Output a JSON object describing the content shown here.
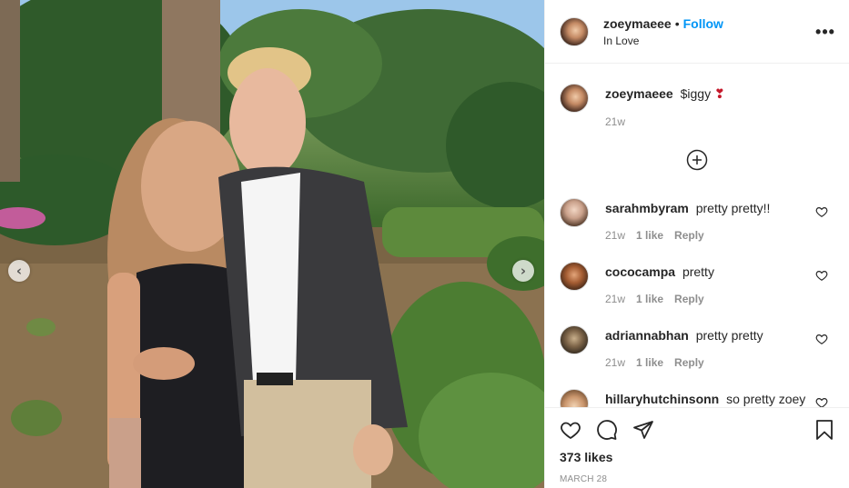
{
  "post": {
    "username": "zoeymaeee",
    "follow_label": "Follow",
    "separator": "•",
    "location": "In Love",
    "more_label": "•••"
  },
  "caption": {
    "username": "zoeymaeee",
    "text": "$iggy",
    "emoji": "❣",
    "time": "21w"
  },
  "comments": [
    {
      "username": "sarahmbyram",
      "text": "pretty pretty!!",
      "time": "21w",
      "likes": "1 like",
      "reply": "Reply"
    },
    {
      "username": "cococampa",
      "text": "pretty",
      "time": "21w",
      "likes": "1 like",
      "reply": "Reply"
    },
    {
      "username": "adriannabhan",
      "text": "pretty pretty",
      "time": "21w",
      "likes": "1 like",
      "reply": "Reply"
    },
    {
      "username": "hillaryhutchinsonn",
      "text": "so pretty zoey",
      "time": "",
      "likes": "",
      "reply": ""
    }
  ],
  "actions": {
    "likes_count": "373 likes",
    "date": "MARCH 28"
  },
  "icons": {
    "prev": "chevron-left-icon",
    "next": "chevron-right-icon",
    "load_more": "plus-circle-icon",
    "like": "heart-icon",
    "comment": "comment-icon",
    "share": "paper-plane-icon",
    "save": "bookmark-icon"
  },
  "colors": {
    "accent": "#0095f6",
    "text": "#262626",
    "muted": "#8e8e8e",
    "divider": "#efefef"
  }
}
